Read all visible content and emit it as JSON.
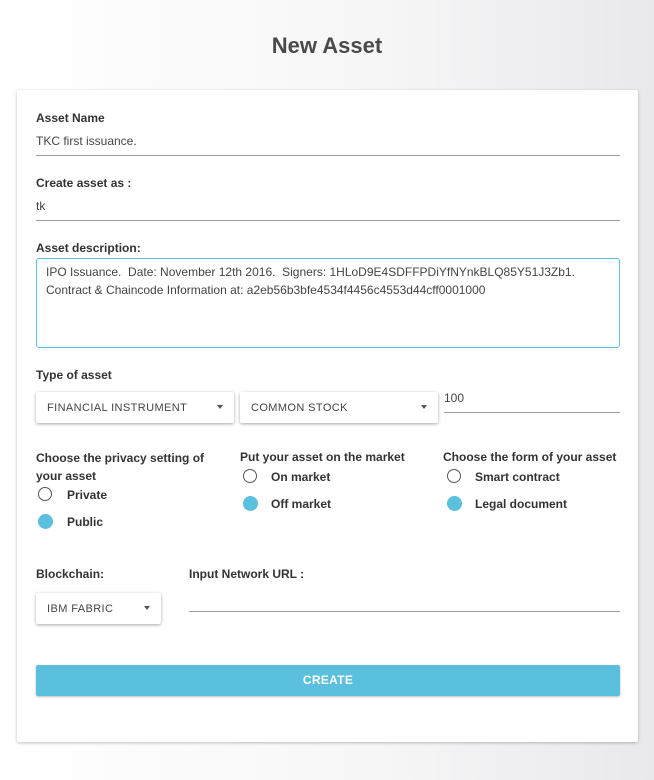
{
  "page": {
    "title": "New Asset"
  },
  "asset_name": {
    "label": "Asset Name",
    "value": "TKC first issuance."
  },
  "create_as": {
    "label": "Create asset as :",
    "value": "tk"
  },
  "description": {
    "label": "Asset description:",
    "value": "IPO Issuance.  Date: November 12th 2016.  Signers: 1HLoD9E4SDFFPDiYfNYnkBLQ85Y51J3Zb1.  Contract & Chaincode Information at: a2eb56b3bfe4534f4456c4553d44cff0001000"
  },
  "asset_type": {
    "label": "Type of asset",
    "category": "FINANCIAL INSTRUMENT",
    "subtype": "COMMON STOCK",
    "quantity": "100"
  },
  "privacy": {
    "label": "Choose the privacy setting of your asset",
    "options": [
      {
        "label": "Private",
        "checked": false
      },
      {
        "label": "Public",
        "checked": true
      }
    ]
  },
  "market": {
    "label": "Put your asset on the market",
    "options": [
      {
        "label": "On market",
        "checked": false
      },
      {
        "label": "Off market",
        "checked": true
      }
    ]
  },
  "form": {
    "label": "Choose the form of your asset",
    "options": [
      {
        "label": "Smart contract",
        "checked": false
      },
      {
        "label": "Legal document",
        "checked": true
      }
    ]
  },
  "blockchain": {
    "label": "Blockchain:",
    "value": "IBM FABRIC"
  },
  "network_url": {
    "label": "Input Network URL :",
    "value": ""
  },
  "actions": {
    "create_label": "CREATE"
  },
  "colors": {
    "accent": "#5bbfde",
    "title": "#4a4a4a"
  },
  "icons": {
    "select_caret": "caret-down-icon"
  }
}
